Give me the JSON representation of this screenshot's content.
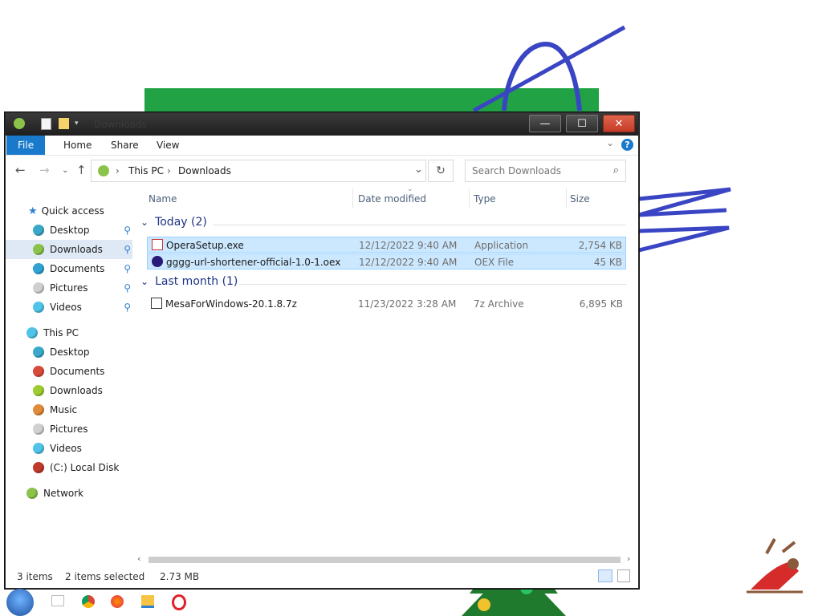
{
  "window": {
    "title": "Downloads",
    "controls": {
      "minimize": "—",
      "maximize": "☐",
      "close": "✕"
    }
  },
  "ribbon": {
    "tabs": [
      "File",
      "Home",
      "Share",
      "View"
    ],
    "help": "?"
  },
  "address": {
    "path": [
      "This PC",
      "Downloads"
    ],
    "separator": "›",
    "search_placeholder": "Search Downloads"
  },
  "nav": {
    "quick_access": "Quick access",
    "quick_items": [
      {
        "label": "Desktop",
        "color": "#3aa9c9"
      },
      {
        "label": "Downloads",
        "color": "#8bc34a"
      },
      {
        "label": "Documents",
        "color": "#2fa3d3"
      },
      {
        "label": "Pictures",
        "color": "#cfcfcf"
      },
      {
        "label": "Videos",
        "color": "#4fc3e8"
      }
    ],
    "this_pc": "This PC",
    "pc_items": [
      {
        "label": "Desktop",
        "color": "#3aa9c9"
      },
      {
        "label": "Documents",
        "color": "#d84a3a"
      },
      {
        "label": "Downloads",
        "color": "#9ccc2e"
      },
      {
        "label": "Music",
        "color": "#e08a3a"
      },
      {
        "label": "Pictures",
        "color": "#d0d0d0"
      },
      {
        "label": "Videos",
        "color": "#4fc3e8"
      },
      {
        "label": "(C:) Local Disk",
        "color": "#c0392b"
      }
    ],
    "network": "Network"
  },
  "columns": [
    "Name",
    "Date modified",
    "Type",
    "Size"
  ],
  "groups": [
    {
      "label": "Today (2)",
      "files": [
        {
          "name": "OperaSetup.exe",
          "date": "12/12/2022 9:40 AM",
          "type": "Application",
          "size": "2,754 KB",
          "selected": true,
          "icon": "opera-setup-icon"
        },
        {
          "name": "gggg-url-shortener-official-1.0-1.oex",
          "date": "12/12/2022 9:40 AM",
          "type": "OEX File",
          "size": "45 KB",
          "selected": true,
          "icon": "oex-file-icon"
        }
      ]
    },
    {
      "label": "Last month (1)",
      "files": [
        {
          "name": "MesaForWindows-20.1.8.7z",
          "date": "11/23/2022 3:28 AM",
          "type": "7z Archive",
          "size": "6,895 KB",
          "selected": false,
          "icon": "archive-icon"
        }
      ]
    }
  ],
  "status": {
    "count": "3 items",
    "selection": "2 items selected",
    "size": "2.73 MB"
  },
  "colors": {
    "accent": "#1979ca",
    "selection": "#cce8ff",
    "group_header": "#1e3287"
  }
}
